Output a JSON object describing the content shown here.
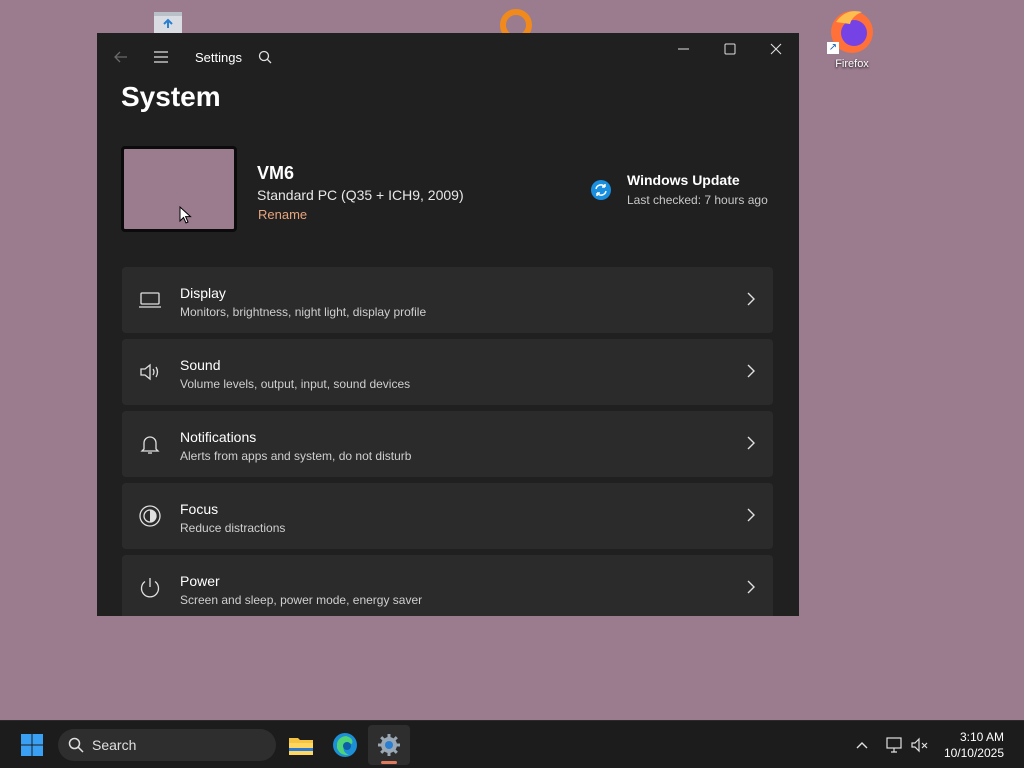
{
  "desktop": {
    "firefox_label": "Firefox"
  },
  "window": {
    "app_title": "Settings",
    "page_title": "System"
  },
  "pc": {
    "name": "VM6",
    "model": "Standard PC (Q35 + ICH9, 2009)",
    "rename_label": "Rename"
  },
  "windows_update": {
    "title": "Windows Update",
    "subtitle": "Last checked: 7 hours ago"
  },
  "cards": [
    {
      "title": "Display",
      "subtitle": "Monitors, brightness, night light, display profile",
      "icon": "monitor-icon"
    },
    {
      "title": "Sound",
      "subtitle": "Volume levels, output, input, sound devices",
      "icon": "speaker-icon"
    },
    {
      "title": "Notifications",
      "subtitle": "Alerts from apps and system, do not disturb",
      "icon": "bell-icon"
    },
    {
      "title": "Focus",
      "subtitle": "Reduce distractions",
      "icon": "focus-icon"
    },
    {
      "title": "Power",
      "subtitle": "Screen and sleep, power mode, energy saver",
      "icon": "power-icon"
    }
  ],
  "taskbar": {
    "search_label": "Search",
    "time": "3:10 AM",
    "date": "10/10/2025"
  },
  "colors": {
    "desktop": "#9b7b8e",
    "window_bg": "#202020",
    "card_bg": "#2b2b2b",
    "accent_link": "#e6a57e",
    "update_blue": "#1a8fe0"
  }
}
